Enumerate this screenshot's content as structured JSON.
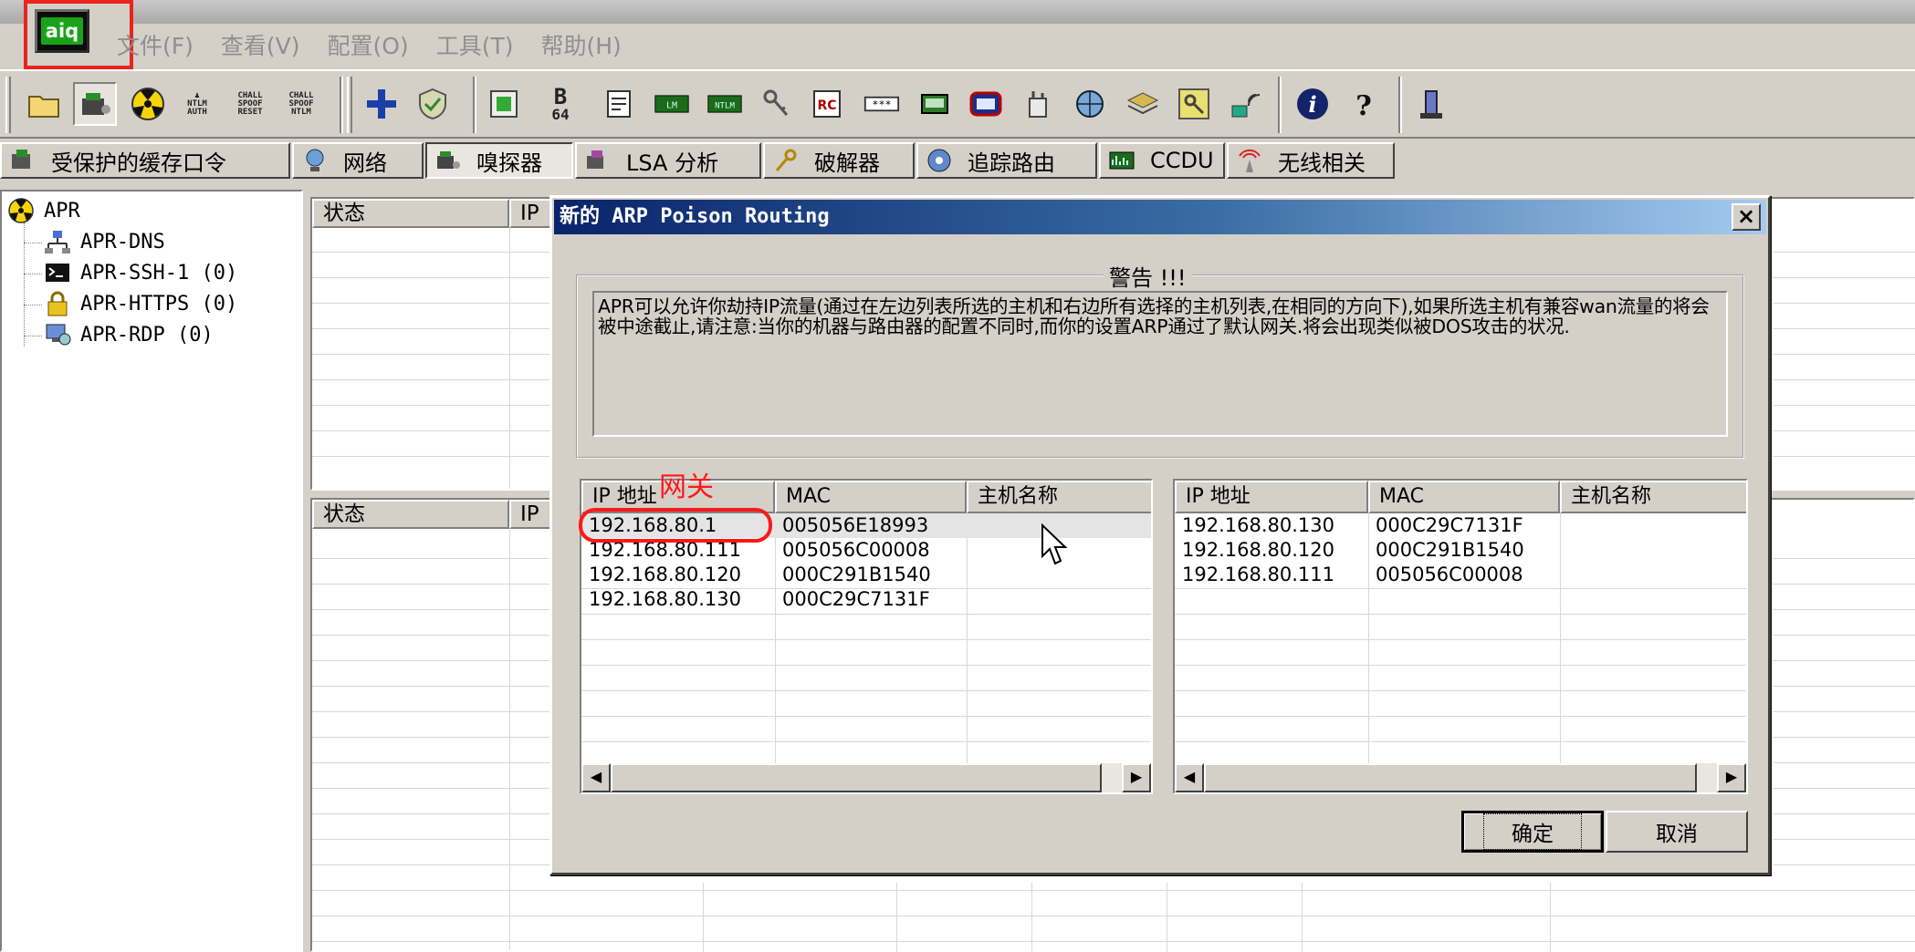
{
  "app": {
    "logo_text": "aiq",
    "menu": [
      "文件(F)",
      "查看(V)",
      "配置(O)",
      "工具(T)",
      "帮助(H)"
    ]
  },
  "toolbar": {
    "icons": [
      "open-folder-icon",
      "sniffer-icon",
      "apr-radiation-icon",
      "ntlm-auth-icon",
      "chall-spoof-reset-icon",
      "chall-spoof-ntlm-icon",
      "add-plus-icon",
      "shield-icon",
      "hash-icon",
      "base64-icon",
      "notes-icon",
      "lm-hash-icon",
      "ntlm-hash-icon",
      "keys-icon",
      "rc-icon",
      "password-box-icon",
      "network-card-icon",
      "router-icon",
      "wrench-tools-icon",
      "network-globe-icon",
      "stack-icon",
      "key-icon",
      "wireless-icon",
      "info-icon",
      "help-icon",
      "cain-tower-icon"
    ],
    "labels": {
      "ntlm_auth": [
        "NTLM",
        "AUTH"
      ],
      "chall_spoof_reset": [
        "CHALL",
        "SPOOF",
        "RESET"
      ],
      "chall_spoof_ntlm": [
        "CHALL",
        "SPOOF",
        "NTLM"
      ],
      "base64": [
        "B",
        "64"
      ],
      "lm": "LM",
      "ntlm": "NTLM",
      "rc": "RC"
    }
  },
  "tabs": [
    {
      "label": "受保护的缓存口令",
      "icon": "cached-password-icon"
    },
    {
      "label": "网络",
      "icon": "network-icon"
    },
    {
      "label": "嗅探器",
      "icon": "sniffer-icon",
      "active": true
    },
    {
      "label": "LSA 分析",
      "icon": "lsa-icon"
    },
    {
      "label": "破解器",
      "icon": "cracker-icon"
    },
    {
      "label": "追踪路由",
      "icon": "traceroute-icon"
    },
    {
      "label": "CCDU",
      "icon": "ccdu-icon"
    },
    {
      "label": "无线相关",
      "icon": "wireless-icon"
    }
  ],
  "tree": {
    "root": "APR",
    "children": [
      "APR-DNS",
      "APR-SSH-1  (0)",
      "APR-HTTPS  (0)",
      "APR-RDP  (0)"
    ]
  },
  "bg_lists": {
    "top_headers": [
      "状态",
      "IP"
    ],
    "bottom_headers": [
      "状态",
      "IP"
    ]
  },
  "dialog": {
    "title": "新的 ARP Poison Routing",
    "close": "×",
    "warning_legend": "警告 !!!",
    "warning_text": "APR可以允许你劫持IP流量(通过在左边列表所选的主机和右边所有选择的主机列表,在相同的方向下),如果所选主机有兼容wan流量的将会被中途截止,请注意:当你的机器与路由器的配置不同时,而你的设置ARP通过了默认网关.将会出现类似被DOS攻击的状况.",
    "left_list": {
      "headers": [
        "IP 地址",
        "MAC",
        "主机名称"
      ],
      "rows": [
        [
          "192.168.80.1",
          "005056E18993",
          ""
        ],
        [
          "192.168.80.111",
          "005056C00008",
          ""
        ],
        [
          "192.168.80.120",
          "000C291B1540",
          ""
        ],
        [
          "192.168.80.130",
          "000C29C7131F",
          ""
        ]
      ]
    },
    "right_list": {
      "headers": [
        "IP 地址",
        "MAC",
        "主机名称"
      ],
      "rows": [
        [
          "192.168.80.130",
          "000C29C7131F",
          ""
        ],
        [
          "192.168.80.120",
          "000C291B1540",
          ""
        ],
        [
          "192.168.80.111",
          "005056C00008",
          ""
        ]
      ]
    },
    "ok": "确定",
    "cancel": "取消",
    "scroll_left": "◀",
    "scroll_right": "▶"
  },
  "annotation": {
    "label": "网关",
    "color": "#ff1818"
  }
}
